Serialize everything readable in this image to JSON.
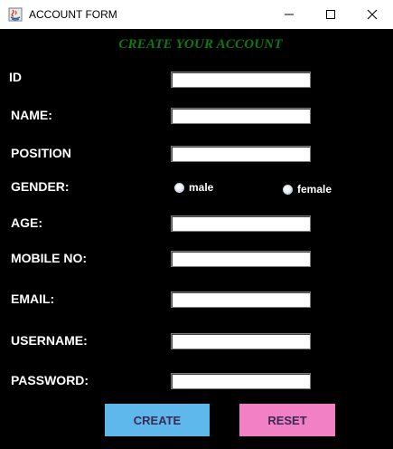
{
  "window": {
    "title": "ACCOUNT FORM"
  },
  "form": {
    "heading": "CREATE YOUR ACCOUNT",
    "labels": {
      "id": "ID",
      "name": "NAME:",
      "position": "POSITION",
      "gender": "GENDER:",
      "age": "AGE:",
      "mobile": "MOBILE NO:",
      "email": "EMAIL:",
      "username": "USERNAME:",
      "password": "PASSWORD:"
    },
    "values": {
      "id": "",
      "name": "",
      "position": "",
      "age": "",
      "mobile": "",
      "email": "",
      "username": "",
      "password": ""
    },
    "gender_options": [
      "male",
      "female"
    ],
    "buttons": {
      "create": "CREATE",
      "reset": "RESET"
    }
  },
  "colors": {
    "background": "#000000",
    "heading": "#0e7a0d",
    "create_button": "#5fb8ec",
    "reset_button": "#f180c4"
  },
  "icons": [
    "java-app-icon",
    "minimize-icon",
    "maximize-icon",
    "close-icon"
  ]
}
